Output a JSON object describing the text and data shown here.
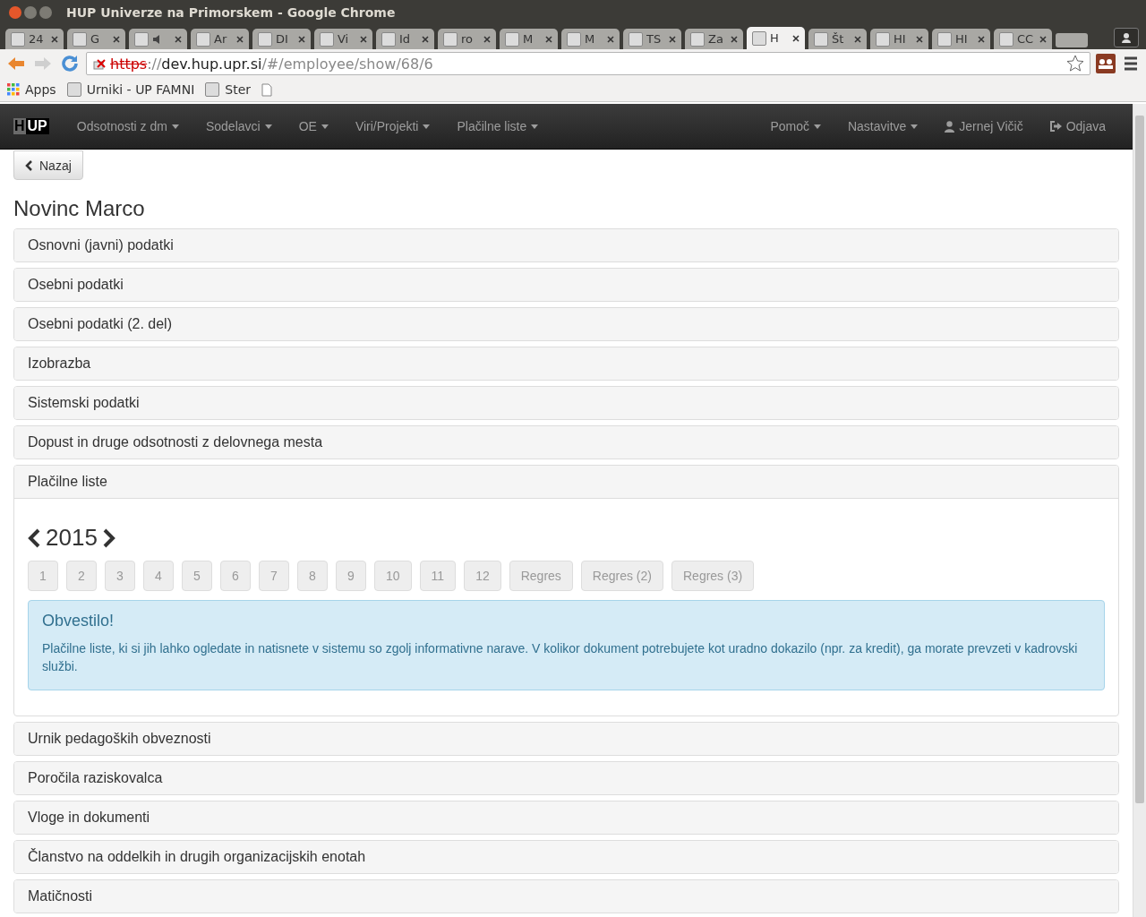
{
  "window": {
    "title": "HUP Univerze na Primorskem - Google Chrome"
  },
  "tabs": [
    {
      "label": "24",
      "selected": false,
      "audio": false
    },
    {
      "label": "G",
      "selected": false,
      "audio": false
    },
    {
      "selected": false,
      "audio": true
    },
    {
      "label": "Ar",
      "selected": false,
      "audio": false
    },
    {
      "label": "DI",
      "selected": false,
      "audio": false
    },
    {
      "label": "Vi",
      "selected": false,
      "audio": false
    },
    {
      "label": "Id",
      "selected": false,
      "audio": false
    },
    {
      "label": "ro",
      "selected": false,
      "audio": false
    },
    {
      "label": "M",
      "selected": false,
      "audio": false
    },
    {
      "label": "M",
      "selected": false,
      "audio": false
    },
    {
      "label": "TS",
      "selected": false,
      "audio": false
    },
    {
      "label": "Za",
      "selected": false,
      "audio": false
    },
    {
      "label": "H",
      "selected": true,
      "audio": false
    },
    {
      "label": "Št",
      "selected": false,
      "audio": false
    },
    {
      "label": "HI",
      "selected": false,
      "audio": false
    },
    {
      "label": "HI",
      "selected": false,
      "audio": false
    },
    {
      "label": "CC",
      "selected": false,
      "audio": false
    }
  ],
  "address_bar": {
    "scheme": "https",
    "separator": "://",
    "host": "dev.hup.upr.si",
    "path": "/#/employee/show/68/6"
  },
  "bookmarks": [
    {
      "label": "Apps",
      "kind": "apps"
    },
    {
      "label": "Urniki - UP FAMNI",
      "kind": "site"
    },
    {
      "label": "Ster",
      "kind": "site"
    },
    {
      "kind": "page"
    }
  ],
  "navbar": {
    "logo": {
      "left": "H",
      "right": "UP"
    },
    "menu": [
      {
        "label": "Odsotnosti z dm",
        "kind": "dropdown"
      },
      {
        "label": "Sodelavci",
        "kind": "dropdown"
      },
      {
        "label": "OE",
        "kind": "dropdown"
      },
      {
        "label": "Viri/Projekti",
        "kind": "dropdown"
      },
      {
        "label": "Plačilne liste",
        "kind": "dropdown"
      }
    ],
    "right_menu": [
      {
        "label": "Pomoč",
        "kind": "dropdown"
      },
      {
        "label": "Nastavitve",
        "kind": "dropdown"
      },
      {
        "label": "Jernej Vičič",
        "kind": "user"
      },
      {
        "label": "Odjava",
        "kind": "logout"
      }
    ]
  },
  "back_button": "Nazaj",
  "heading": "Novinc Marco",
  "panels": [
    {
      "title": "Osnovni (javni) podatki",
      "expanded": false
    },
    {
      "title": "Osebni podatki",
      "expanded": false
    },
    {
      "title": "Osebni podatki (2. del)",
      "expanded": false
    },
    {
      "title": "Izobrazba",
      "expanded": false
    },
    {
      "title": "Sistemski podatki",
      "expanded": false
    },
    {
      "title": "Dopust in druge odsotnosti z delovnega mesta",
      "expanded": false
    },
    {
      "title": "Plačilne liste",
      "expanded": true,
      "body": {
        "year": "2015",
        "months": [
          "1",
          "2",
          "3",
          "4",
          "5",
          "6",
          "7",
          "8",
          "9",
          "10",
          "11",
          "12",
          "Regres",
          "Regres (2)",
          "Regres (3)"
        ],
        "alert": {
          "title": "Obvestilo!",
          "text": "Plačilne liste, ki si jih lahko ogledate in natisnete v sistemu so zgolj informativne narave. V kolikor dokument potrebujete kot uradno dokazilo (npr. za kredit), ga morate prevzeti v kadrovski službi."
        }
      }
    },
    {
      "title": "Urnik pedagoških obveznosti",
      "expanded": false
    },
    {
      "title": "Poročila raziskovalca",
      "expanded": false
    },
    {
      "title": "Vloge in dokumenti",
      "expanded": false
    },
    {
      "title": "Članstvo na oddelkih in drugih organizacijskih enotah",
      "expanded": false
    },
    {
      "title": "Matičnosti",
      "expanded": false
    }
  ]
}
